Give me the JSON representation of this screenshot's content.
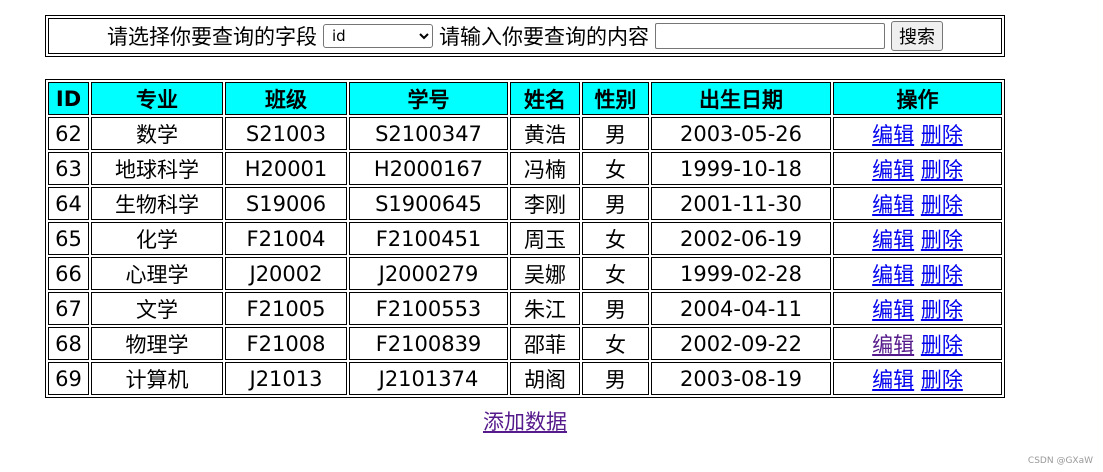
{
  "search": {
    "prompt_field": "请选择你要查询的字段",
    "selected_field": "id",
    "prompt_content": "请输入你要查询的内容",
    "input_value": "",
    "button_label": "搜索"
  },
  "table": {
    "headers": [
      "ID",
      "专业",
      "班级",
      "学号",
      "姓名",
      "性别",
      "出生日期",
      "操作"
    ],
    "rows": [
      {
        "id": "62",
        "major": "数学",
        "class": "S21003",
        "student_no": "S2100347",
        "name": "黄浩",
        "gender": "男",
        "birth": "2003-05-26",
        "edit": "编辑",
        "delete": "删除"
      },
      {
        "id": "63",
        "major": "地球科学",
        "class": "H20001",
        "student_no": "H2000167",
        "name": "冯楠",
        "gender": "女",
        "birth": "1999-10-18",
        "edit": "编辑",
        "delete": "删除"
      },
      {
        "id": "64",
        "major": "生物科学",
        "class": "S19006",
        "student_no": "S1900645",
        "name": "李刚",
        "gender": "男",
        "birth": "2001-11-30",
        "edit": "编辑",
        "delete": "删除"
      },
      {
        "id": "65",
        "major": "化学",
        "class": "F21004",
        "student_no": "F2100451",
        "name": "周玉",
        "gender": "女",
        "birth": "2002-06-19",
        "edit": "编辑",
        "delete": "删除"
      },
      {
        "id": "66",
        "major": "心理学",
        "class": "J20002",
        "student_no": "J2000279",
        "name": "吴娜",
        "gender": "女",
        "birth": "1999-02-28",
        "edit": "编辑",
        "delete": "删除"
      },
      {
        "id": "67",
        "major": "文学",
        "class": "F21005",
        "student_no": "F2100553",
        "name": "朱江",
        "gender": "男",
        "birth": "2004-04-11",
        "edit": "编辑",
        "delete": "删除"
      },
      {
        "id": "68",
        "major": "物理学",
        "class": "F21008",
        "student_no": "F2100839",
        "name": "邵菲",
        "gender": "女",
        "birth": "2002-09-22",
        "edit": "编辑",
        "delete": "删除"
      },
      {
        "id": "69",
        "major": "计算机",
        "class": "J21013",
        "student_no": "J2101374",
        "name": "胡阁",
        "gender": "男",
        "birth": "2003-08-19",
        "edit": "编辑",
        "delete": "删除"
      }
    ]
  },
  "add_link": "添加数据",
  "watermark": "CSDN @GXaW",
  "colors": {
    "header_bg": "#00ffff",
    "link": "#0000ee",
    "visited_link": "#551a8b"
  }
}
